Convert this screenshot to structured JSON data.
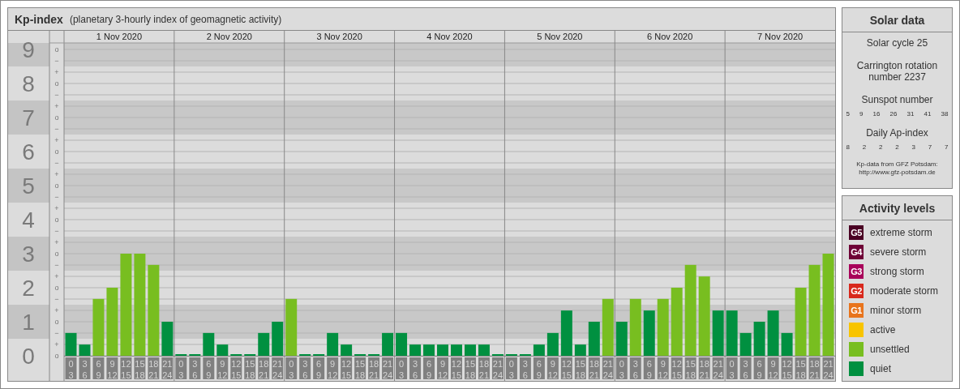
{
  "kp_panel": {
    "title": "Kp-index",
    "subtitle": "(planetary 3-hourly index of geomagnetic activity)",
    "days": [
      "1 Nov 2020",
      "2 Nov 2020",
      "3 Nov 2020",
      "4 Nov 2020",
      "5 Nov 2020",
      "6 Nov 2020",
      "7 Nov 2020"
    ],
    "minor_ticks": [
      "o",
      "−",
      "+",
      "o",
      "−",
      "+",
      "o",
      "−",
      "+",
      "o",
      "−",
      "+",
      "o",
      "−",
      "+",
      "o",
      "−",
      "+",
      "o",
      "−",
      "+",
      "o",
      "−",
      "+",
      "o",
      "−",
      "+",
      "o"
    ],
    "chart_data": {
      "type": "bar",
      "ylim": [
        0,
        9
      ],
      "yticks": [
        0,
        1,
        2,
        3,
        4,
        5,
        6,
        7,
        8,
        9
      ],
      "categories": [
        "0\n3",
        "3\n6",
        "6\n9",
        "9\n12",
        "12\n15",
        "15\n18",
        "18\n21",
        "21\n24",
        "0\n3",
        "3\n6",
        "6\n9",
        "9\n12",
        "12\n15",
        "15\n18",
        "18\n21",
        "21\n24",
        "0\n3",
        "3\n6",
        "6\n9",
        "9\n12",
        "12\n15",
        "15\n18",
        "18\n21",
        "21\n24",
        "0\n3",
        "3\n6",
        "6\n9",
        "9\n12",
        "12\n15",
        "15\n18",
        "18\n21",
        "21\n24",
        "0\n3",
        "3\n6",
        "6\n9",
        "9\n12",
        "12\n15",
        "15\n18",
        "18\n21",
        "21\n24",
        "0\n3",
        "3\n6",
        "6\n9",
        "9\n12",
        "12\n15",
        "15\n18",
        "18\n21",
        "21\n24",
        "0\n3",
        "3\n6",
        "6\n9",
        "9\n12",
        "12\n15",
        "15\n18",
        "18\n21",
        "21\n24"
      ],
      "grid": true,
      "values": [
        0.67,
        0.33,
        1.67,
        2,
        3,
        3,
        2.67,
        1,
        0,
        0,
        0.67,
        0.33,
        0,
        0,
        0.67,
        1,
        1.67,
        0,
        0,
        0.67,
        0.33,
        0,
        0,
        0.67,
        0.67,
        0.33,
        0.33,
        0.33,
        0.33,
        0.33,
        0.33,
        0,
        0,
        0,
        0.33,
        0.67,
        1.33,
        0.33,
        1,
        1.67,
        1,
        1.67,
        1.33,
        1.67,
        2,
        2.67,
        2.33,
        1.33,
        1.33,
        0.67,
        1,
        1.33,
        0.67,
        2,
        2.67,
        3
      ]
    }
  },
  "solar_data": {
    "title": "Solar data",
    "cycle": "Solar cycle 25",
    "rotation": "Carrington rotation number 2237",
    "sunspot_label": "Sunspot number",
    "sunspots": [
      "5",
      "9",
      "16",
      "26",
      "31",
      "41",
      "38"
    ],
    "ap_label": "Daily Ap-index",
    "ap": [
      "8",
      "2",
      "2",
      "2",
      "3",
      "7",
      "7"
    ],
    "source": "Kp-data from GFZ Potsdam:",
    "source_url": "http://www.gfz-potsdam.de"
  },
  "activity_levels": {
    "title": "Activity levels",
    "items": [
      {
        "badge": "G5",
        "label": "extreme storm",
        "color": "#4a0023"
      },
      {
        "badge": "G4",
        "label": "severe storm",
        "color": "#6e0036"
      },
      {
        "badge": "G3",
        "label": "strong storm",
        "color": "#a8005a"
      },
      {
        "badge": "G2",
        "label": "moderate storm",
        "color": "#d8281c"
      },
      {
        "badge": "G1",
        "label": "minor storm",
        "color": "#e8741c"
      },
      {
        "label": "active",
        "color": "#f8c400"
      },
      {
        "label": "unsettled",
        "color": "#78be20"
      },
      {
        "label": "quiet",
        "color": "#009040"
      }
    ]
  }
}
